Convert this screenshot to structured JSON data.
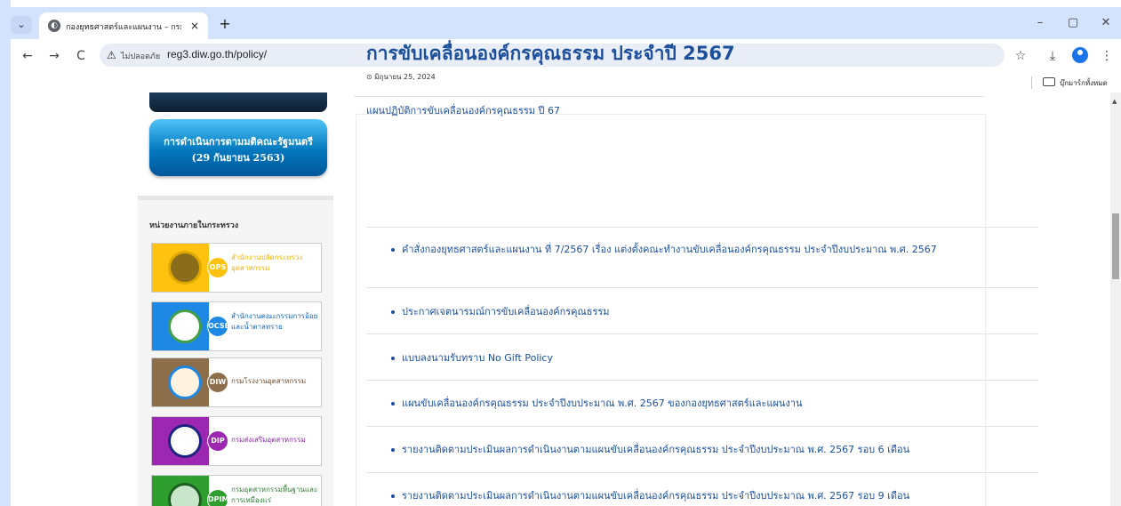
{
  "browser": {
    "tab_title": "กองยุทธศาสตร์และแผนงาน – กรมโร",
    "tab_close": "×",
    "new_tab": "+",
    "minimize": "–",
    "restore": "▢",
    "close": "✕",
    "back": "←",
    "forward": "→",
    "reload": "C",
    "security_warning": "ไม่ปลอดภัย",
    "url": "reg3.diw.go.th/policy/",
    "bookmark_star": "☆",
    "download": "⤓",
    "menu": "⋮",
    "bookmarks_folder_label": "บุ๊กมาร์กทั้งหมด"
  },
  "sidebar": {
    "mou_banner": {
      "line1": "การดำเนินการตามมติคณะรัฐมนตรี",
      "line2": "(29 กันยายน 2563)"
    },
    "heading": "หน่วยงานภายในกระทรวง",
    "agencies": [
      {
        "code": "OPS",
        "name": "สำนักงานปลัดกระทรวงอุตสาหกรรม",
        "color": "#ffc20e",
        "name_color": "#f3b200"
      },
      {
        "code": "OCSB",
        "name": "สำนักงานคณะกรรมการอ้อยและน้ำตาลทราย",
        "color": "#1e88e5",
        "name_color": "#1565c0"
      },
      {
        "code": "DIW",
        "name": "กรมโรงงานอุตสาหกรรม",
        "color": "#8d6e4a",
        "name_color": "#6d4c2f"
      },
      {
        "code": "DIP",
        "name": "กรมส่งเสริมอุตสาหกรรม",
        "color": "#9c27b0",
        "name_color": "#8e24aa"
      },
      {
        "code": "DPIM",
        "name": "กรมอุตสาหกรรมพื้นฐานและการเหมืองแร่",
        "color": "#2e9e2e",
        "name_color": "#2e7d32"
      }
    ]
  },
  "post": {
    "title": "การขับเคลื่อนองค์กรคุณธรรม ประจำปี 2567",
    "date": "มิถุนายน 25, 2024",
    "subtitle": "แผนปฏิบัติการขับเคลื่อนองค์กรคุณธรรม ปี 67",
    "items": [
      "คำสั่งกองยุทธศาสตร์และแผนงาน ที่ 7/2567 เรื่อง แต่งตั้งคณะทำงานขับเคลื่อนองค์กรคุณธรรม ประจำปีงบประมาณ พ.ศ. 2567",
      "ประกาศเจตนารมณ์การขับเคลื่อนองค์กรคุณธรรม",
      "แบบลงนามรับทราบ No Gift Policy",
      "แผนขับเคลื่อนองค์กรคุณธรรม ประจำปีงบประมาณ พ.ศ. 2567 ของกองยุทธศาสตร์และแผนงาน",
      "รายงานติดตามประเมินผลการดำเนินงานตามแผนขับเคลื่อนองค์กรคุณธรรม ประจำปีงบประมาณ พ.ศ. 2567 รอบ 6 เดือน",
      "รายงานติดตามประเมินผลการดำเนินงานตามแผนขับเคลื่อนองค์กรคุณธรรม ประจำปีงบประมาณ พ.ศ. 2567 รอบ 9 เดือน"
    ]
  }
}
